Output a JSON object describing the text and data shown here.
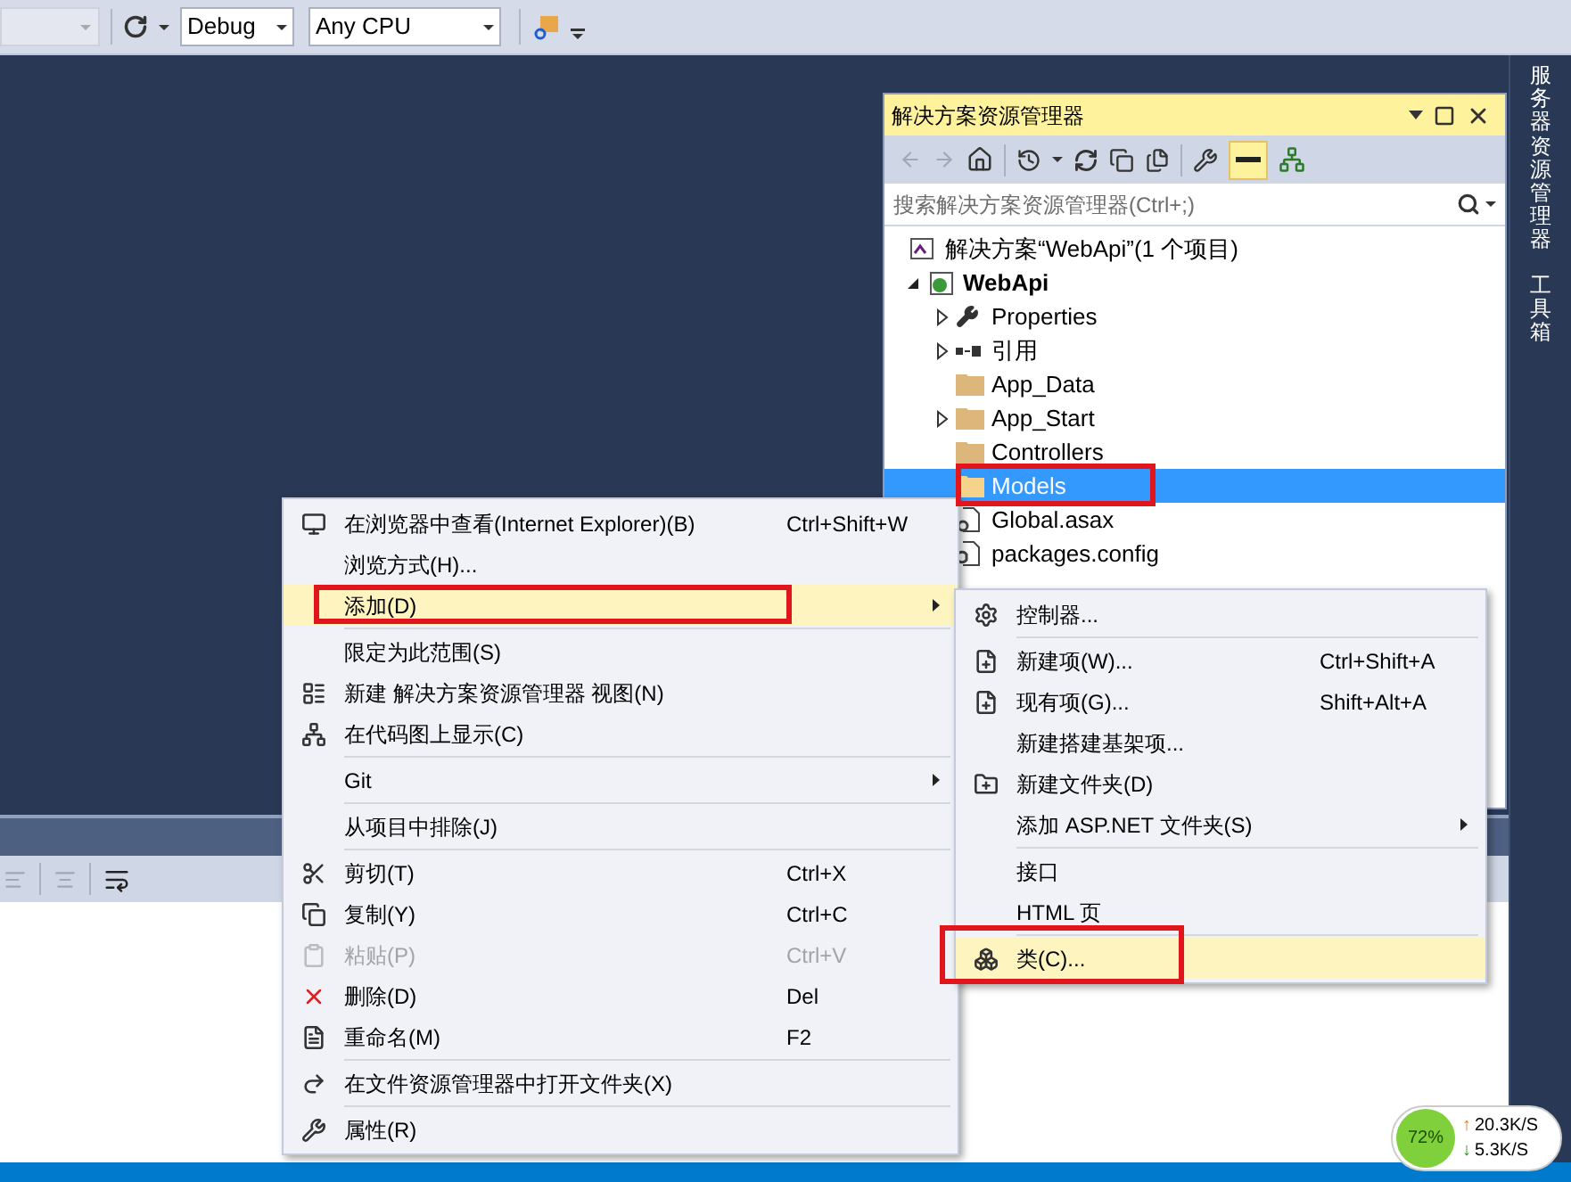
{
  "toolbar": {
    "left_dropdown": {
      "disabled": true
    },
    "configuration": "Debug",
    "platform": "Any CPU"
  },
  "solution_explorer": {
    "title": "解决方案资源管理器",
    "search": {
      "placeholder": "搜索解决方案资源管理器(Ctrl+;)"
    },
    "tree": [
      {
        "label": "解决方案“WebApi”(1 个项目)",
        "kind": "solution",
        "selected": false,
        "marked": false,
        "children": [
          {
            "label": "WebApi",
            "kind": "project",
            "expanded": true,
            "selected": false,
            "marked": false,
            "children": [
              {
                "label": "Properties",
                "kind": "properties",
                "expanded": false,
                "selected": false,
                "marked": false
              },
              {
                "label": "引用",
                "kind": "references",
                "expanded": false,
                "selected": false,
                "marked": false
              },
              {
                "label": "App_Data",
                "kind": "folder",
                "selected": false,
                "marked": false
              },
              {
                "label": "App_Start",
                "kind": "folder",
                "expanded": false,
                "selected": false,
                "marked": false
              },
              {
                "label": "Controllers",
                "kind": "folder",
                "selected": false,
                "marked": false
              },
              {
                "label": "Models",
                "kind": "folder",
                "selected": true,
                "marked": true
              },
              {
                "label": "Global.asax",
                "kind": "file",
                "selected": false,
                "marked": false
              },
              {
                "label": "packages.config",
                "kind": "config",
                "selected": false,
                "marked": false
              }
            ]
          }
        ]
      }
    ]
  },
  "side_tabs": [
    "服务器资源管理器",
    "工具箱"
  ],
  "context_menu": {
    "groups": [
      [
        {
          "label": "在浏览器中查看(Internet Explorer)(B)",
          "shortcut": "Ctrl+Shift+W",
          "submenu": false,
          "disabled": false,
          "selected": false,
          "marked": false
        },
        {
          "label": "浏览方式(H)...",
          "submenu": false,
          "disabled": false,
          "selected": false,
          "marked": false
        },
        {
          "label": "添加(D)",
          "submenu": true,
          "disabled": false,
          "selected": true,
          "marked": true
        }
      ],
      [
        {
          "label": "限定为此范围(S)",
          "submenu": false,
          "disabled": false,
          "selected": false,
          "marked": false
        },
        {
          "label": "新建 解决方案资源管理器 视图(N)",
          "submenu": false,
          "disabled": false,
          "selected": false,
          "marked": false
        },
        {
          "label": "在代码图上显示(C)",
          "submenu": false,
          "disabled": false,
          "selected": false,
          "marked": false
        }
      ],
      [
        {
          "label": "Git",
          "submenu": true,
          "disabled": false,
          "selected": false,
          "marked": false
        }
      ],
      [
        {
          "label": "从项目中排除(J)",
          "submenu": false,
          "disabled": false,
          "selected": false,
          "marked": false
        }
      ],
      [
        {
          "label": "剪切(T)",
          "shortcut": "Ctrl+X",
          "submenu": false,
          "disabled": false,
          "selected": false,
          "marked": false
        },
        {
          "label": "复制(Y)",
          "shortcut": "Ctrl+C",
          "submenu": false,
          "disabled": false,
          "selected": false,
          "marked": false
        },
        {
          "label": "粘贴(P)",
          "shortcut": "Ctrl+V",
          "submenu": false,
          "disabled": true,
          "selected": false,
          "marked": false
        },
        {
          "label": "删除(D)",
          "shortcut": "Del",
          "submenu": false,
          "disabled": false,
          "selected": false,
          "marked": false
        },
        {
          "label": "重命名(M)",
          "shortcut": "F2",
          "submenu": false,
          "disabled": false,
          "selected": false,
          "marked": false
        }
      ],
      [
        {
          "label": "在文件资源管理器中打开文件夹(X)",
          "submenu": false,
          "disabled": false,
          "selected": false,
          "marked": false
        }
      ],
      [
        {
          "label": "属性(R)",
          "submenu": false,
          "disabled": false,
          "selected": false,
          "marked": false
        }
      ]
    ]
  },
  "add_submenu": {
    "groups": [
      [
        {
          "label": "控制器...",
          "submenu": false,
          "disabled": false,
          "selected": false,
          "marked": false
        }
      ],
      [
        {
          "label": "新建项(W)...",
          "shortcut": "Ctrl+Shift+A",
          "submenu": false,
          "disabled": false,
          "selected": false,
          "marked": false
        },
        {
          "label": "现有项(G)...",
          "shortcut": "Shift+Alt+A",
          "submenu": false,
          "disabled": false,
          "selected": false,
          "marked": false
        },
        {
          "label": "新建搭建基架项...",
          "submenu": false,
          "disabled": false,
          "selected": false,
          "marked": false
        },
        {
          "label": "新建文件夹(D)",
          "submenu": false,
          "disabled": false,
          "selected": false,
          "marked": false
        },
        {
          "label": "添加 ASP.NET 文件夹(S)",
          "submenu": true,
          "disabled": false,
          "selected": false,
          "marked": false
        }
      ],
      [
        {
          "label": "接口",
          "submenu": false,
          "disabled": false,
          "selected": false,
          "marked": false
        },
        {
          "label": "HTML 页",
          "submenu": false,
          "disabled": false,
          "selected": false,
          "marked": false
        }
      ],
      [
        {
          "label": "类(C)...",
          "submenu": false,
          "disabled": false,
          "selected": true,
          "marked": true
        }
      ]
    ]
  },
  "network_monitor": {
    "percent": "72%",
    "upload_arrow": "↑",
    "upload": "20.3K/S",
    "download_arrow": "↓",
    "download": "5.3K/S"
  }
}
